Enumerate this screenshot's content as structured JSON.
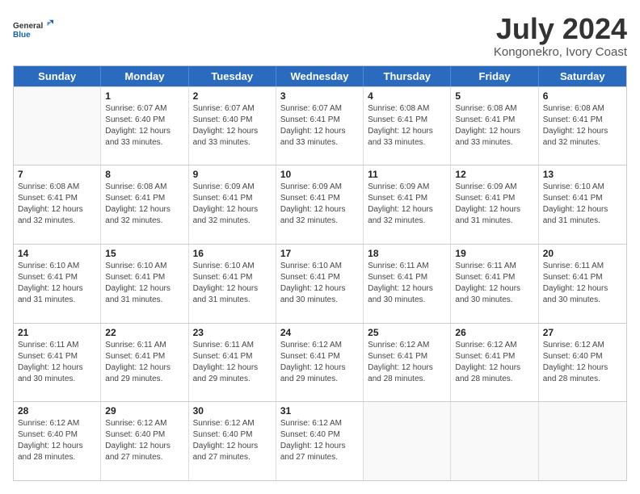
{
  "header": {
    "logo_line1": "General",
    "logo_line2": "Blue",
    "title": "July 2024",
    "subtitle": "Kongonekro, Ivory Coast"
  },
  "calendar": {
    "days_of_week": [
      "Sunday",
      "Monday",
      "Tuesday",
      "Wednesday",
      "Thursday",
      "Friday",
      "Saturday"
    ],
    "weeks": [
      [
        {
          "day": "",
          "empty": true
        },
        {
          "day": "1",
          "sunrise": "6:07 AM",
          "sunset": "6:40 PM",
          "daylight": "12 hours and 33 minutes."
        },
        {
          "day": "2",
          "sunrise": "6:07 AM",
          "sunset": "6:40 PM",
          "daylight": "12 hours and 33 minutes."
        },
        {
          "day": "3",
          "sunrise": "6:07 AM",
          "sunset": "6:41 PM",
          "daylight": "12 hours and 33 minutes."
        },
        {
          "day": "4",
          "sunrise": "6:08 AM",
          "sunset": "6:41 PM",
          "daylight": "12 hours and 33 minutes."
        },
        {
          "day": "5",
          "sunrise": "6:08 AM",
          "sunset": "6:41 PM",
          "daylight": "12 hours and 33 minutes."
        },
        {
          "day": "6",
          "sunrise": "6:08 AM",
          "sunset": "6:41 PM",
          "daylight": "12 hours and 32 minutes."
        }
      ],
      [
        {
          "day": "7",
          "sunrise": "6:08 AM",
          "sunset": "6:41 PM",
          "daylight": "12 hours and 32 minutes."
        },
        {
          "day": "8",
          "sunrise": "6:08 AM",
          "sunset": "6:41 PM",
          "daylight": "12 hours and 32 minutes."
        },
        {
          "day": "9",
          "sunrise": "6:09 AM",
          "sunset": "6:41 PM",
          "daylight": "12 hours and 32 minutes."
        },
        {
          "day": "10",
          "sunrise": "6:09 AM",
          "sunset": "6:41 PM",
          "daylight": "12 hours and 32 minutes."
        },
        {
          "day": "11",
          "sunrise": "6:09 AM",
          "sunset": "6:41 PM",
          "daylight": "12 hours and 32 minutes."
        },
        {
          "day": "12",
          "sunrise": "6:09 AM",
          "sunset": "6:41 PM",
          "daylight": "12 hours and 31 minutes."
        },
        {
          "day": "13",
          "sunrise": "6:10 AM",
          "sunset": "6:41 PM",
          "daylight": "12 hours and 31 minutes."
        }
      ],
      [
        {
          "day": "14",
          "sunrise": "6:10 AM",
          "sunset": "6:41 PM",
          "daylight": "12 hours and 31 minutes."
        },
        {
          "day": "15",
          "sunrise": "6:10 AM",
          "sunset": "6:41 PM",
          "daylight": "12 hours and 31 minutes."
        },
        {
          "day": "16",
          "sunrise": "6:10 AM",
          "sunset": "6:41 PM",
          "daylight": "12 hours and 31 minutes."
        },
        {
          "day": "17",
          "sunrise": "6:10 AM",
          "sunset": "6:41 PM",
          "daylight": "12 hours and 30 minutes."
        },
        {
          "day": "18",
          "sunrise": "6:11 AM",
          "sunset": "6:41 PM",
          "daylight": "12 hours and 30 minutes."
        },
        {
          "day": "19",
          "sunrise": "6:11 AM",
          "sunset": "6:41 PM",
          "daylight": "12 hours and 30 minutes."
        },
        {
          "day": "20",
          "sunrise": "6:11 AM",
          "sunset": "6:41 PM",
          "daylight": "12 hours and 30 minutes."
        }
      ],
      [
        {
          "day": "21",
          "sunrise": "6:11 AM",
          "sunset": "6:41 PM",
          "daylight": "12 hours and 30 minutes."
        },
        {
          "day": "22",
          "sunrise": "6:11 AM",
          "sunset": "6:41 PM",
          "daylight": "12 hours and 29 minutes."
        },
        {
          "day": "23",
          "sunrise": "6:11 AM",
          "sunset": "6:41 PM",
          "daylight": "12 hours and 29 minutes."
        },
        {
          "day": "24",
          "sunrise": "6:12 AM",
          "sunset": "6:41 PM",
          "daylight": "12 hours and 29 minutes."
        },
        {
          "day": "25",
          "sunrise": "6:12 AM",
          "sunset": "6:41 PM",
          "daylight": "12 hours and 28 minutes."
        },
        {
          "day": "26",
          "sunrise": "6:12 AM",
          "sunset": "6:41 PM",
          "daylight": "12 hours and 28 minutes."
        },
        {
          "day": "27",
          "sunrise": "6:12 AM",
          "sunset": "6:40 PM",
          "daylight": "12 hours and 28 minutes."
        }
      ],
      [
        {
          "day": "28",
          "sunrise": "6:12 AM",
          "sunset": "6:40 PM",
          "daylight": "12 hours and 28 minutes."
        },
        {
          "day": "29",
          "sunrise": "6:12 AM",
          "sunset": "6:40 PM",
          "daylight": "12 hours and 27 minutes."
        },
        {
          "day": "30",
          "sunrise": "6:12 AM",
          "sunset": "6:40 PM",
          "daylight": "12 hours and 27 minutes."
        },
        {
          "day": "31",
          "sunrise": "6:12 AM",
          "sunset": "6:40 PM",
          "daylight": "12 hours and 27 minutes."
        },
        {
          "day": "",
          "empty": true
        },
        {
          "day": "",
          "empty": true
        },
        {
          "day": "",
          "empty": true
        }
      ]
    ]
  }
}
